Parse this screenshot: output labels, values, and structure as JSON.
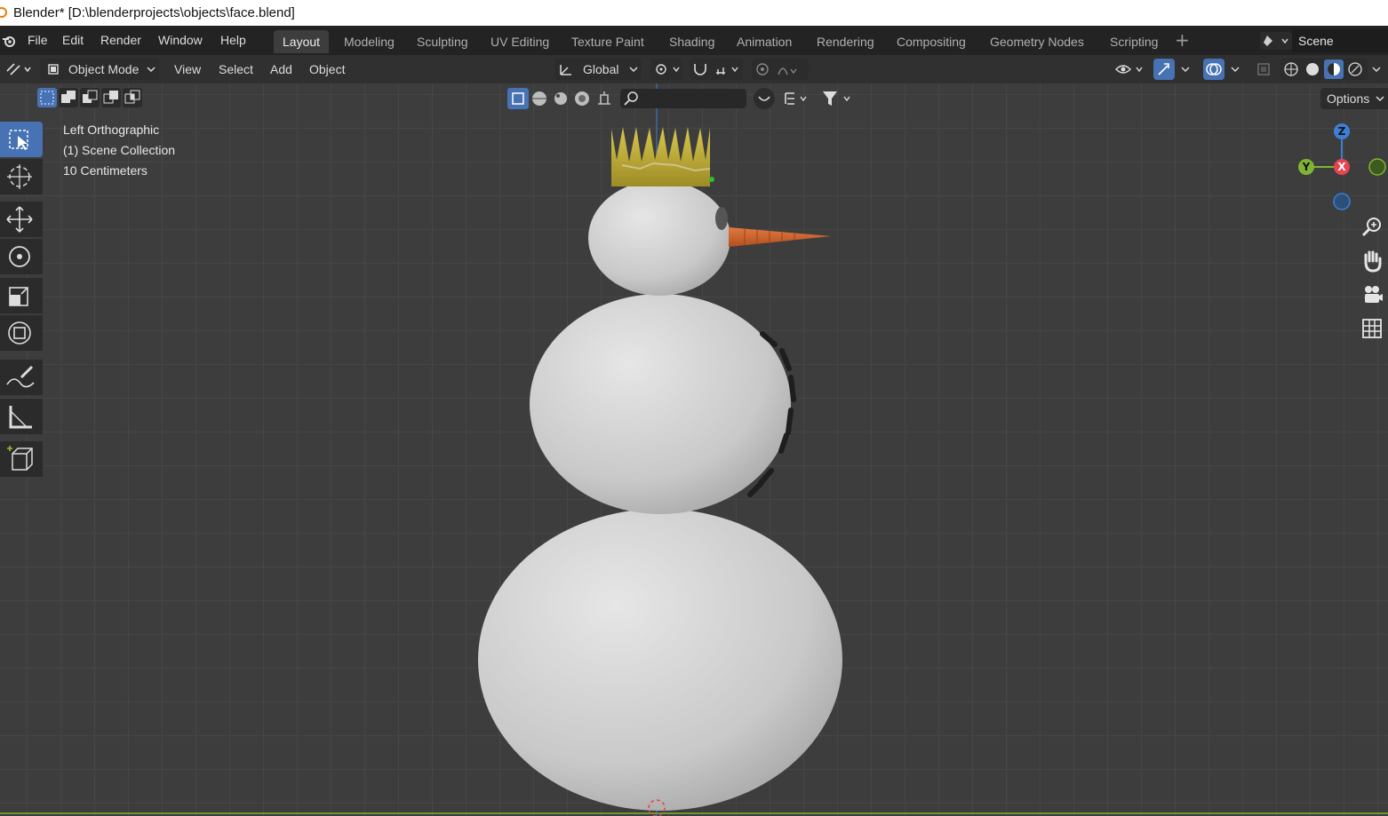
{
  "window": {
    "title": "Blender* [D:\\blenderprojects\\objects\\face.blend]"
  },
  "menu": {
    "items": [
      "File",
      "Edit",
      "Render",
      "Window",
      "Help"
    ]
  },
  "workspaces": {
    "tabs": [
      "Layout",
      "Modeling",
      "Sculpting",
      "UV Editing",
      "Texture Paint",
      "Shading",
      "Animation",
      "Rendering",
      "Compositing",
      "Geometry Nodes",
      "Scripting"
    ],
    "active": "Layout"
  },
  "scene": {
    "name": "Scene"
  },
  "header": {
    "mode": "Object Mode",
    "menus": [
      "View",
      "Select",
      "Add",
      "Object"
    ],
    "orientation": "Global",
    "options_label": "Options"
  },
  "viewport": {
    "view_name": "Left Orthographic",
    "collection": "(1) Scene Collection",
    "scale": "10 Centimeters",
    "gizmo": {
      "z": "Z",
      "y": "Y",
      "x": "X"
    }
  },
  "colors": {
    "accent": "#4772b3",
    "x_axis": "#e8444f",
    "y_axis": "#7fb532",
    "z_axis": "#3d7fd6",
    "crown": "#c9b53a",
    "carrot": "#d1652e",
    "snow": "#d9d9d9"
  },
  "icons": {
    "toolbar": [
      "select-box-icon",
      "cursor-icon",
      "move-icon",
      "rotate-icon",
      "scale-icon",
      "transform-icon",
      "annotate-icon",
      "measure-icon",
      "add-cube-icon"
    ],
    "nav": [
      "zoom-icon",
      "pan-hand-icon",
      "camera-view-icon",
      "grid-toggle-icon"
    ]
  }
}
